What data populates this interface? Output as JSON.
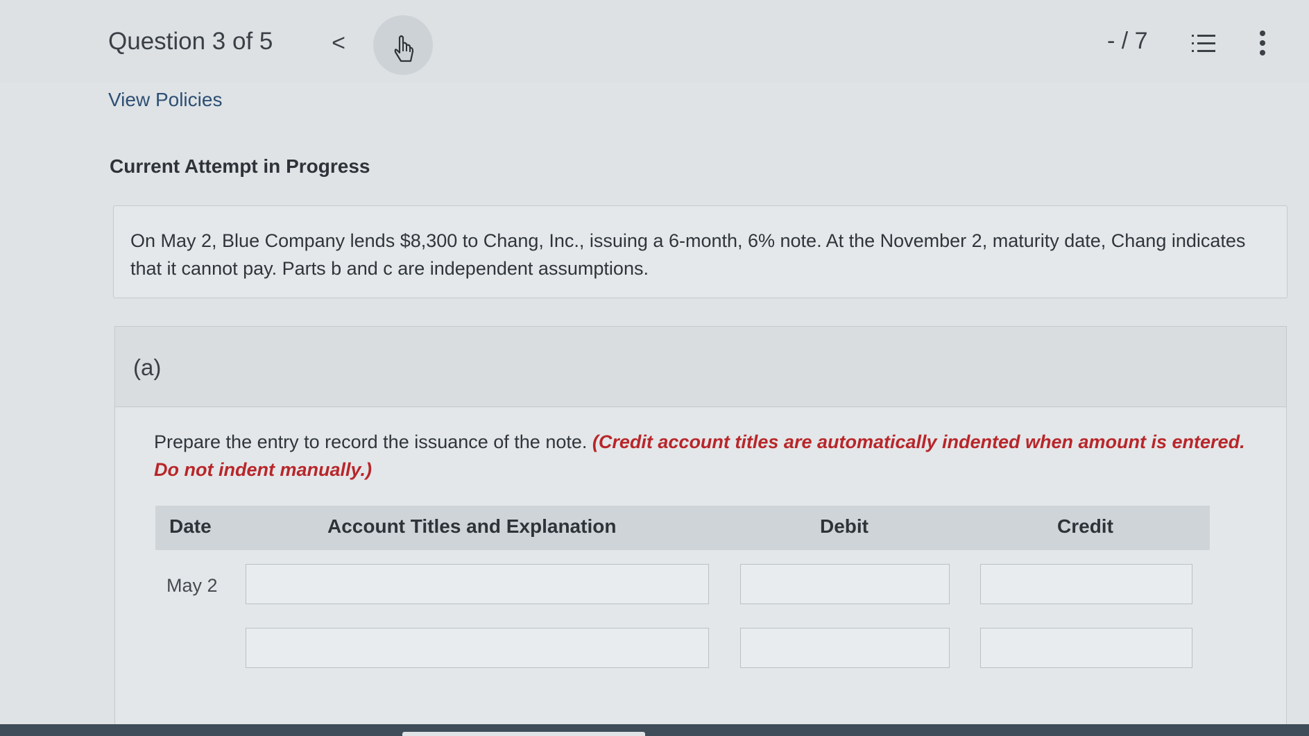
{
  "header": {
    "question_label": "Question 3 of 5",
    "prev_icon": "<",
    "next_icon": "hand-pointer-icon",
    "score": "- / 7",
    "list_icon": "list-icon",
    "more_icon": "more-vertical-icon"
  },
  "links": {
    "view_policies": "View Policies"
  },
  "status": {
    "attempt": "Current Attempt in Progress"
  },
  "problem": {
    "text": "On May 2, Blue Company lends $8,300 to Chang, Inc., issuing a 6-month, 6% note. At the November 2, maturity date, Chang indicates that it cannot pay. Parts b and c are independent assumptions."
  },
  "part_a": {
    "label": "(a)",
    "instruction": "Prepare the entry to record the issuance of the note.",
    "hint": "(Credit account titles are automatically indented when amount is entered. Do not indent manually.)",
    "table": {
      "headers": [
        "Date",
        "Account Titles and Explanation",
        "Debit",
        "Credit"
      ],
      "rows": [
        {
          "date": "May 2",
          "account": "",
          "debit": "",
          "credit": ""
        },
        {
          "date": "",
          "account": "",
          "debit": "",
          "credit": ""
        }
      ]
    }
  },
  "colors": {
    "background": "#dfe3e6",
    "hint_red": "#b8262a",
    "link_blue": "#2e4f73"
  }
}
